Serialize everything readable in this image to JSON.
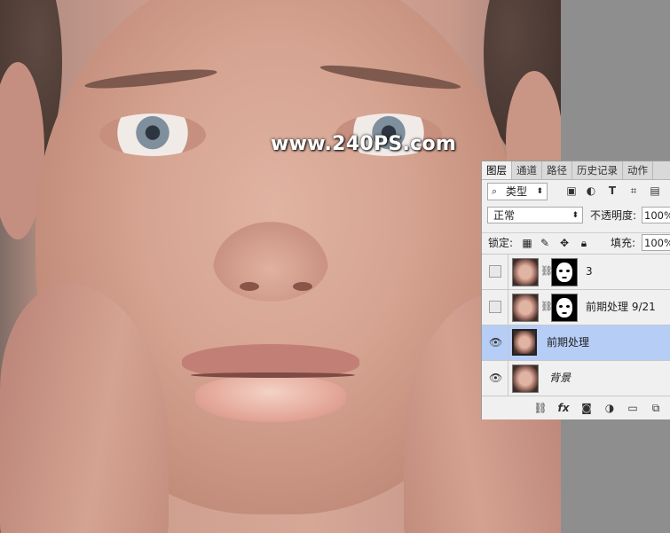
{
  "watermark": "www.240PS.com",
  "panel": {
    "tabs": [
      "图层",
      "通道",
      "路径",
      "历史记录",
      "动作"
    ],
    "filter": {
      "label": "类型",
      "search_icon": "search-icon",
      "dropdown_icon": "chevron-icon"
    },
    "blend_mode": "正常",
    "opacity_label": "不透明度:",
    "opacity_value": "100%",
    "lock_label": "锁定:",
    "fill_label": "填充:",
    "fill_value": "100%",
    "layers": [
      {
        "name": "3",
        "visible": false,
        "has_mask": true,
        "selected": false
      },
      {
        "name": "前期处理 9/21",
        "visible": false,
        "has_mask": true,
        "selected": false
      },
      {
        "name": "前期处理",
        "visible": true,
        "has_mask": false,
        "selected": true
      },
      {
        "name": "背景",
        "visible": true,
        "has_mask": false,
        "selected": false,
        "italic": true
      }
    ],
    "bottom_icons": [
      "link-icon",
      "fx-icon",
      "mask-icon",
      "adjustment-icon",
      "folder-icon",
      "new-layer-icon"
    ],
    "bottom_fx_label": "fx"
  },
  "colors": {
    "panel_bg": "#f0f0f0",
    "selected_layer": "#b6cdf6",
    "canvas_bg": "#8d8d8d"
  }
}
